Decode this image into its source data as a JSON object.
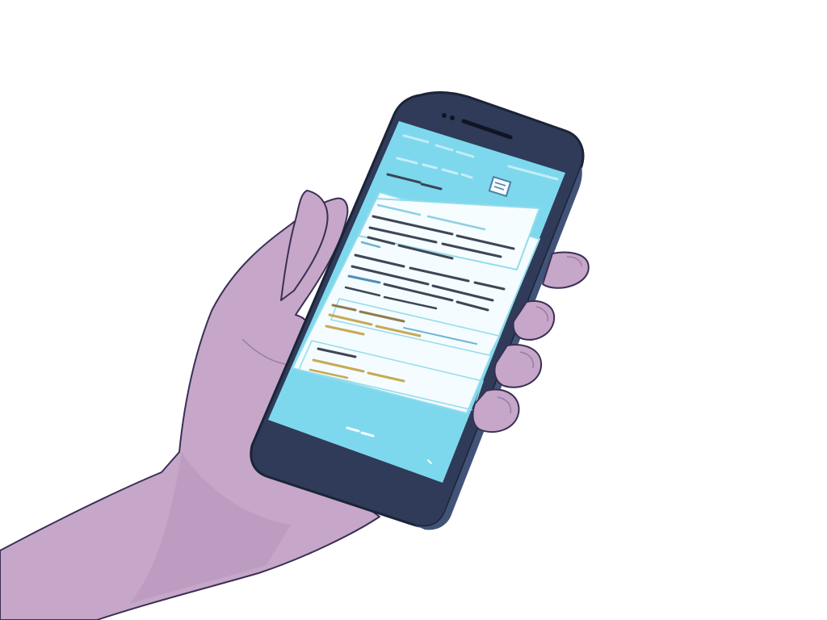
{
  "scene": {
    "description_free": true,
    "colors": {
      "background": "#ffffff",
      "skin": "#c5a5c8",
      "skin_shadow": "#a98aaf",
      "phone_body": "#2e3a57",
      "phone_edge": "#1d2740",
      "screen_accent": "#7fd9ee",
      "screen_card": "#f6fdff",
      "card_border": "#8fdcec",
      "text_dark": "#4d5566",
      "text_blue": "#3f8fb8",
      "text_gold": "#c2a04a"
    },
    "icons": [
      "speaker-grille-icon",
      "front-camera-icon",
      "document-icon"
    ]
  }
}
